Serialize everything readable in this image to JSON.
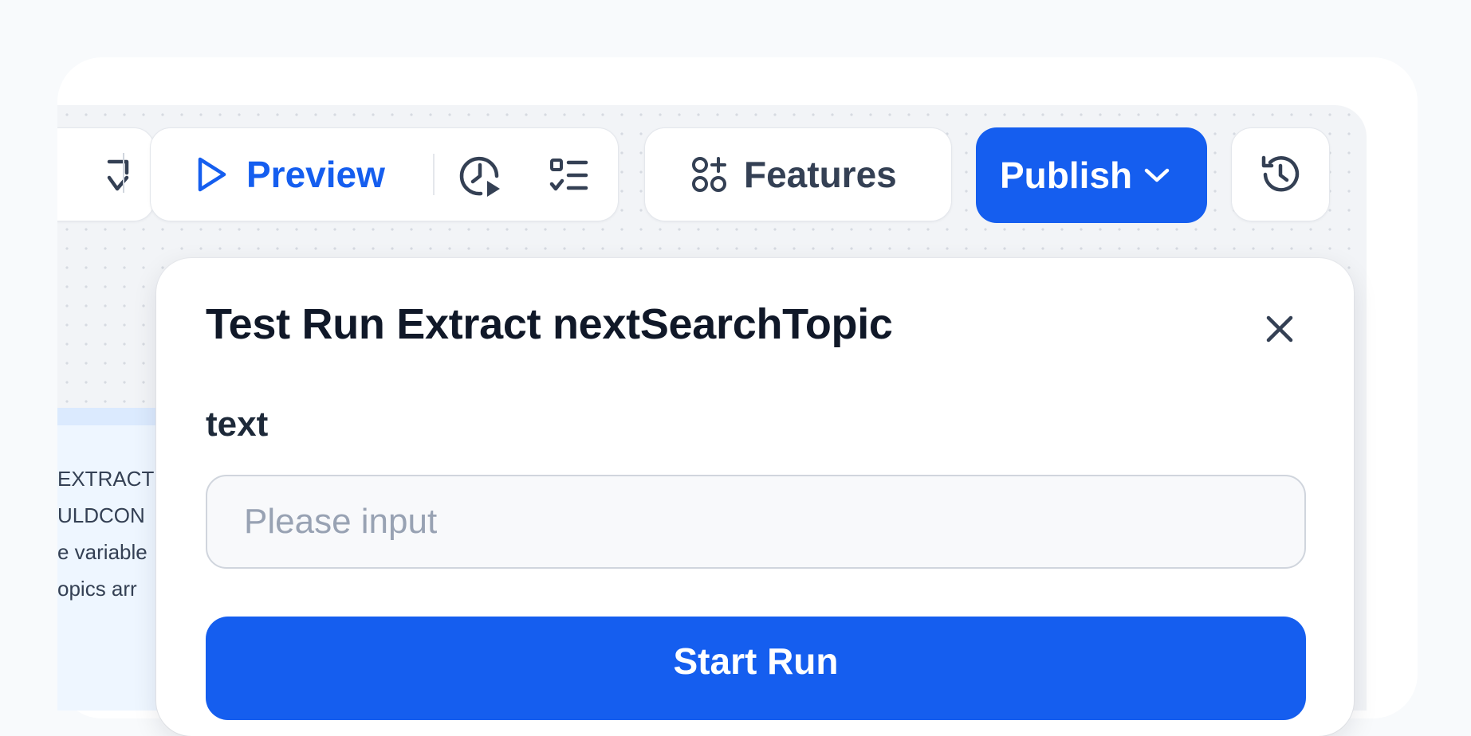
{
  "toolbar": {
    "preview_label": "Preview",
    "features_label": "Features",
    "publish_label": "Publish"
  },
  "node": {
    "lines": [
      "EXTRACT",
      "ULDCON",
      "e variable",
      "opics arr"
    ]
  },
  "dialog": {
    "title": "Test Run Extract nextSearchTopic",
    "field_label": "text",
    "input_placeholder": "Please input",
    "input_value": "",
    "start_label": "Start Run"
  },
  "colors": {
    "accent": "#155eef",
    "preview_text": "#155eef",
    "canvas_bg": "#f2f4f7",
    "title_text": "#101828"
  },
  "icons": [
    "partial-icon",
    "play-icon",
    "run-history-icon",
    "checklist-icon",
    "features-icon",
    "chevron-down-icon",
    "history-icon",
    "close-icon"
  ]
}
